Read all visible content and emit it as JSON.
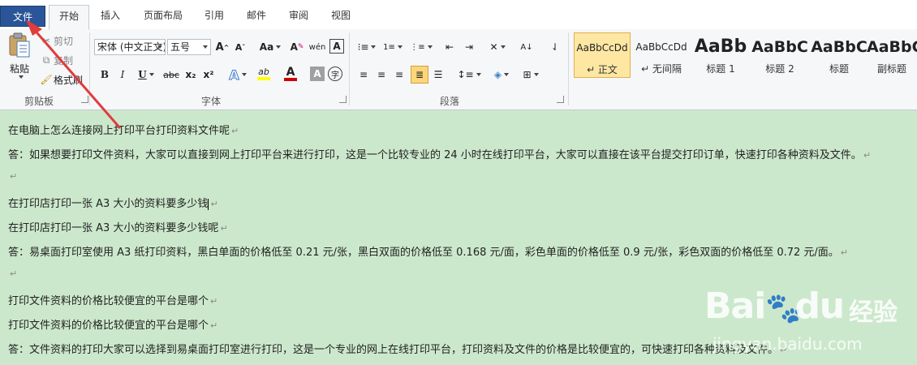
{
  "tabs": {
    "file": "文件",
    "home": "开始",
    "insert": "插入",
    "layout": "页面布局",
    "references": "引用",
    "mailings": "邮件",
    "review": "审阅",
    "view": "视图"
  },
  "clipboard": {
    "paste": "粘贴",
    "cut": "剪切",
    "copy": "复制",
    "format_painter": "格式刷",
    "label": "剪贴板"
  },
  "font": {
    "name": "宋体 (中文正文)",
    "size": "五号",
    "label": "字体",
    "grow": "A",
    "shrink": "A",
    "case": "Aa",
    "clear": "A",
    "phonetic": "wén",
    "border": "A",
    "bold": "B",
    "italic": "I",
    "underline": "U",
    "strike": "abc",
    "subscript": "x₂",
    "superscript": "x²",
    "effects": "A",
    "highlight": "ab",
    "color": "A",
    "shade": "A",
    "enclose": "字",
    "highlight_color": "#ffff00",
    "font_color": "#d00000"
  },
  "paragraph": {
    "label": "段落"
  },
  "styles": [
    {
      "sample": "AaBbCcDd",
      "name": "↵ 正文",
      "selected": true
    },
    {
      "sample": "AaBbCcDd",
      "name": "↵ 无间隔",
      "selected": false
    },
    {
      "sample": "AaBb",
      "name": "标题 1",
      "selected": false
    },
    {
      "sample": "AaBbC",
      "name": "标题 2",
      "selected": false
    },
    {
      "sample": "AaBbC",
      "name": "标题",
      "selected": false
    },
    {
      "sample": "AaBbC",
      "name": "副标题",
      "selected": false
    }
  ],
  "document": {
    "lines": [
      "在电脑上怎么连接网上打印平台打印资料文件呢",
      "答：如果想要打印文件资料，大家可以直接到网上打印平台来进行打印，这是一个比较专业的 24 小时在线打印平台，大家可以直接在该平台提交打印订单，快速打印各种资料及文件。",
      "",
      "在打印店打印一张 A3 大小的资料要多少钱",
      "在打印店打印一张 A3 大小的资料要多少钱呢",
      "答：易桌面打印室使用 A3 纸打印资料，黑白单面的价格低至 0.21 元/张，黑白双面的价格低至 0.168 元/面，彩色单面的价格低至 0.9 元/张，彩色双面的价格低至 0.72 元/面。",
      "",
      "打印文件资料的价格比较便宜的平台是哪个",
      "打印文件资料的价格比较便宜的平台是哪个",
      "答：文件资料的打印大家可以选择到易桌面打印室进行打印，这是一个专业的网上在线打印平台，打印资料及文件的价格是比较便宜的，可快速打印各种资料及文件。"
    ],
    "paragraph_mark": "↵",
    "background": "#cce8cc"
  },
  "watermark": {
    "brand": "Bai",
    "brand_mid": "du",
    "tagline": "经验",
    "url": "jingyan.baidu.com"
  },
  "annotation": {
    "arrow_color": "#e03c3c"
  }
}
